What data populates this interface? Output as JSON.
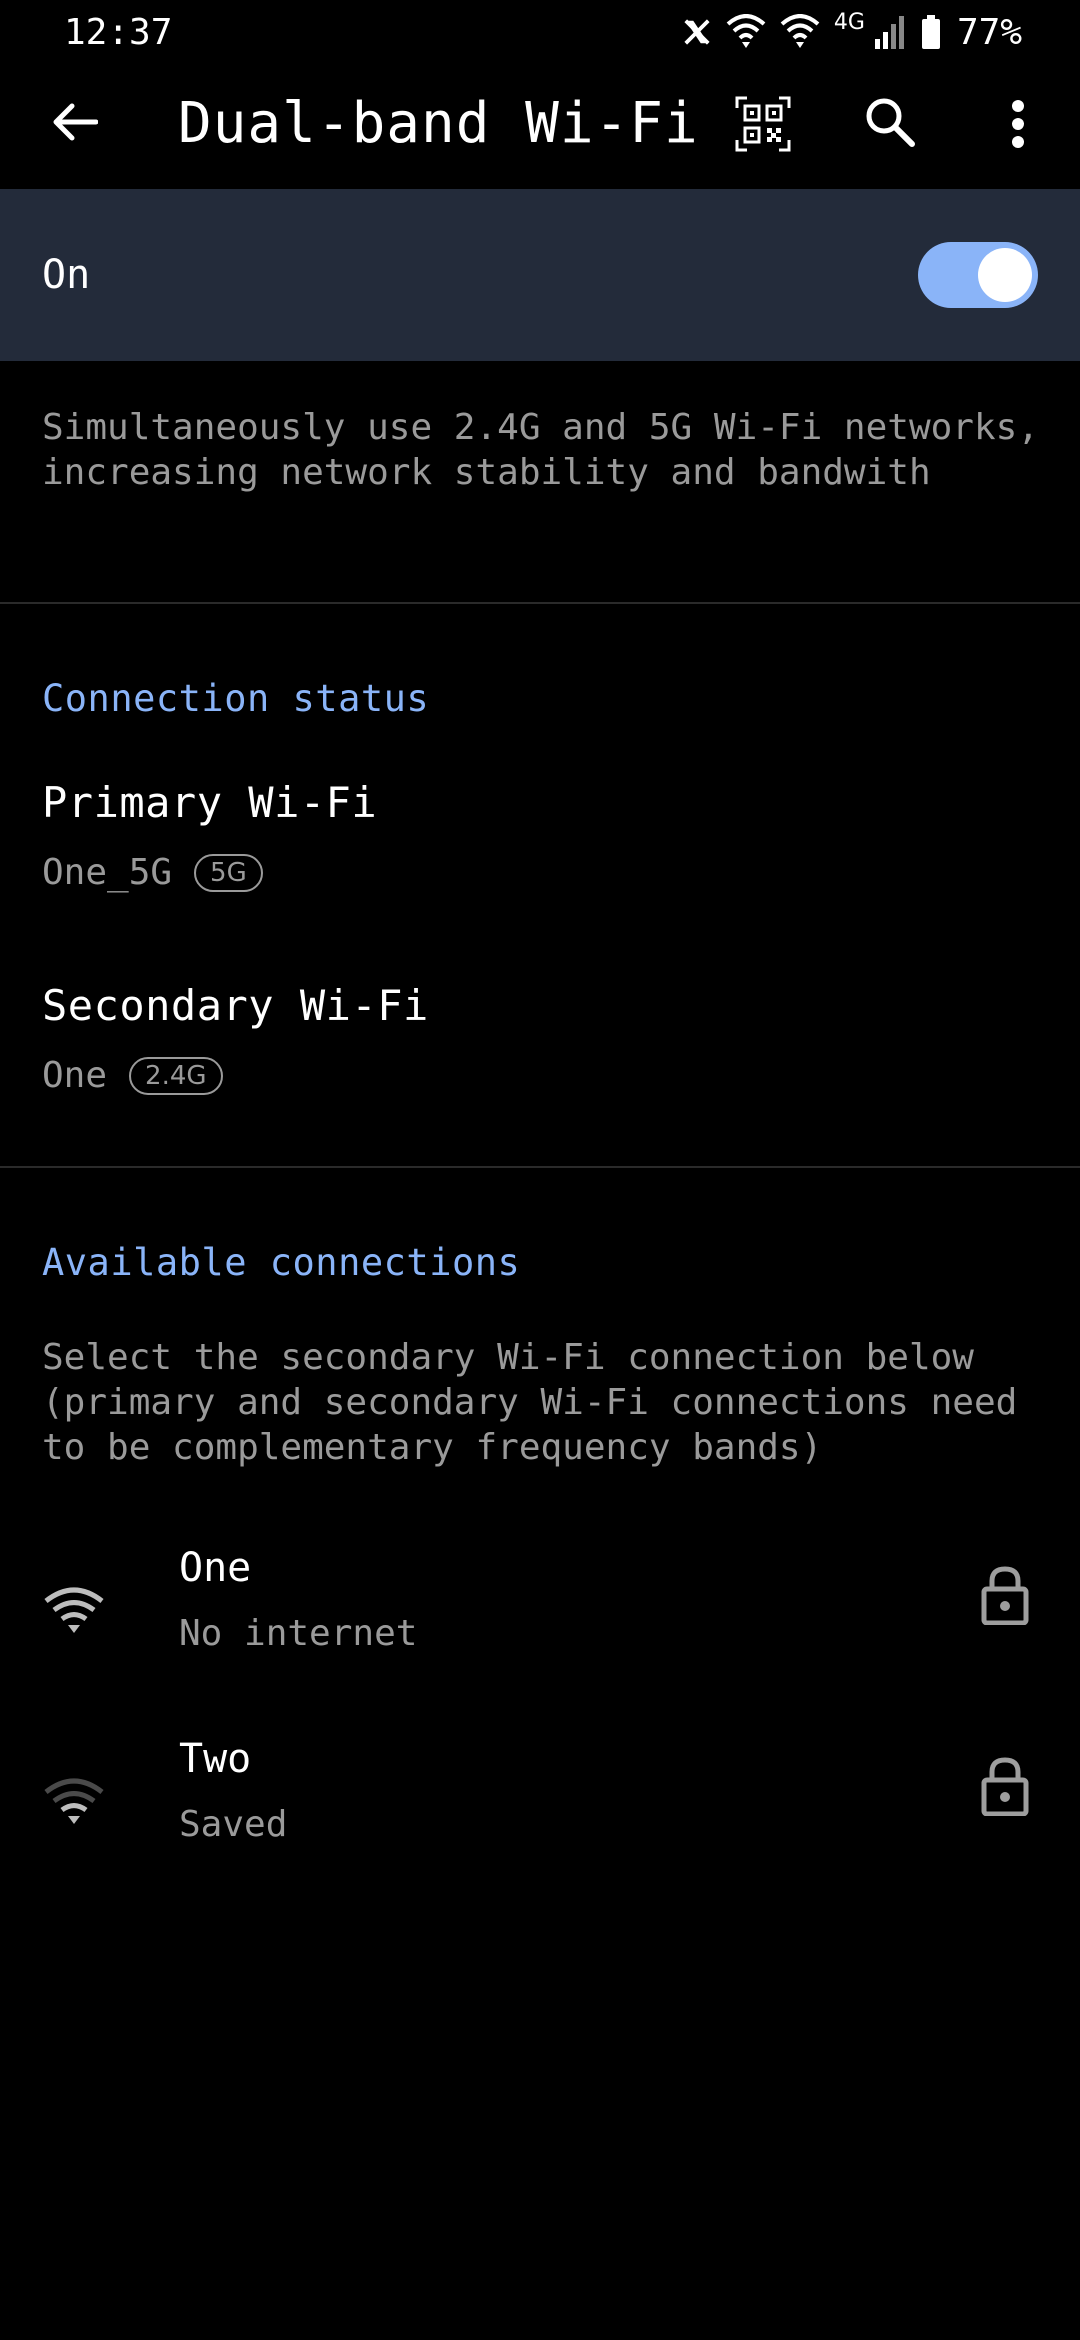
{
  "status_bar": {
    "time": "12:37",
    "network_type": "4G",
    "battery": "77%",
    "icons": [
      "x-app-icon",
      "wifi-icon",
      "wifi-icon",
      "cell-signal-icon",
      "battery-icon"
    ]
  },
  "app_bar": {
    "title": "Dual-band Wi-Fi",
    "icons": [
      "back-arrow-icon",
      "qr-code-icon",
      "search-icon",
      "more-vert-icon"
    ]
  },
  "toggle": {
    "label": "On",
    "state": true
  },
  "description": "Simultaneously use 2.4G and 5G Wi-Fi networks, increasing network stability and bandwith",
  "connection_status": {
    "title": "Connection status",
    "primary": {
      "label": "Primary Wi-Fi",
      "ssid": "One_5G",
      "band": "5G"
    },
    "secondary": {
      "label": "Secondary Wi-Fi",
      "ssid": "One",
      "band": "2.4G"
    }
  },
  "available": {
    "title": "Available connections",
    "description": "Select the secondary Wi-Fi connection below (primary and secondary Wi-Fi connections need to be complementary frequency bands)",
    "networks": [
      {
        "ssid": "One",
        "status": "No internet",
        "secured": true
      },
      {
        "ssid": "Two",
        "status": "Saved",
        "secured": true
      }
    ]
  },
  "colors": {
    "accent": "#8ab4f8",
    "toggle_row_bg": "#232b3a",
    "secondary_text": "#9a9a9a",
    "background": "#000000"
  }
}
